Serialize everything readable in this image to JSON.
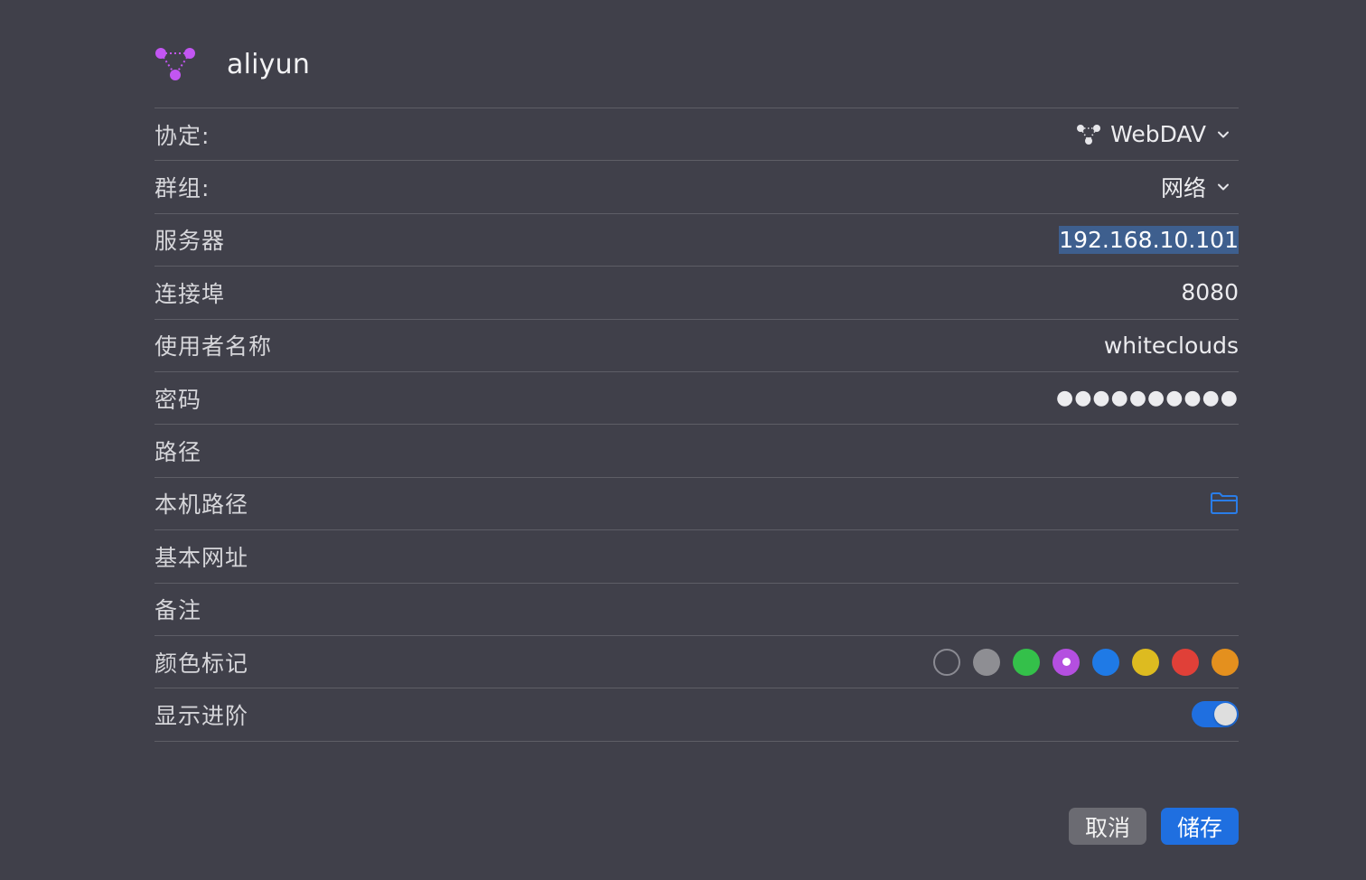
{
  "colors": {
    "background": "#40404a",
    "accent": "#1f6fe0",
    "logo": "#c256f2"
  },
  "header": {
    "logo_icon": "webdav-network-icon",
    "title": "aliyun"
  },
  "form": {
    "protocol": {
      "label": "协定:",
      "value": "WebDAV",
      "icon": "webdav-icon"
    },
    "group": {
      "label": "群组:",
      "value": "网络"
    },
    "server": {
      "label": "服务器",
      "value": "192.168.10.101"
    },
    "port": {
      "label": "连接埠",
      "value": "8080"
    },
    "username": {
      "label": "使用者名称",
      "value": "whiteclouds"
    },
    "password": {
      "label": "密码",
      "value": "●●●●●●●●●●"
    },
    "path": {
      "label": "路径",
      "value": ""
    },
    "local_path": {
      "label": "本机路径",
      "icon": "folder-icon"
    },
    "base_url": {
      "label": "基本网址",
      "value": ""
    },
    "note": {
      "label": "备注",
      "value": ""
    },
    "color_tag": {
      "label": "颜色标记",
      "options": [
        {
          "name": "none",
          "color": ""
        },
        {
          "name": "gray",
          "color": "#8e8e93"
        },
        {
          "name": "green",
          "color": "#34c04a"
        },
        {
          "name": "purple",
          "color": "#b44fe0",
          "selected": true
        },
        {
          "name": "blue",
          "color": "#1f7ae6"
        },
        {
          "name": "yellow",
          "color": "#ddbb20"
        },
        {
          "name": "red",
          "color": "#e04038"
        },
        {
          "name": "orange",
          "color": "#e4901e"
        }
      ]
    },
    "show_advanced": {
      "label": "显示进阶",
      "on": true
    }
  },
  "buttons": {
    "cancel_label": "取消",
    "save_label": "储存"
  }
}
